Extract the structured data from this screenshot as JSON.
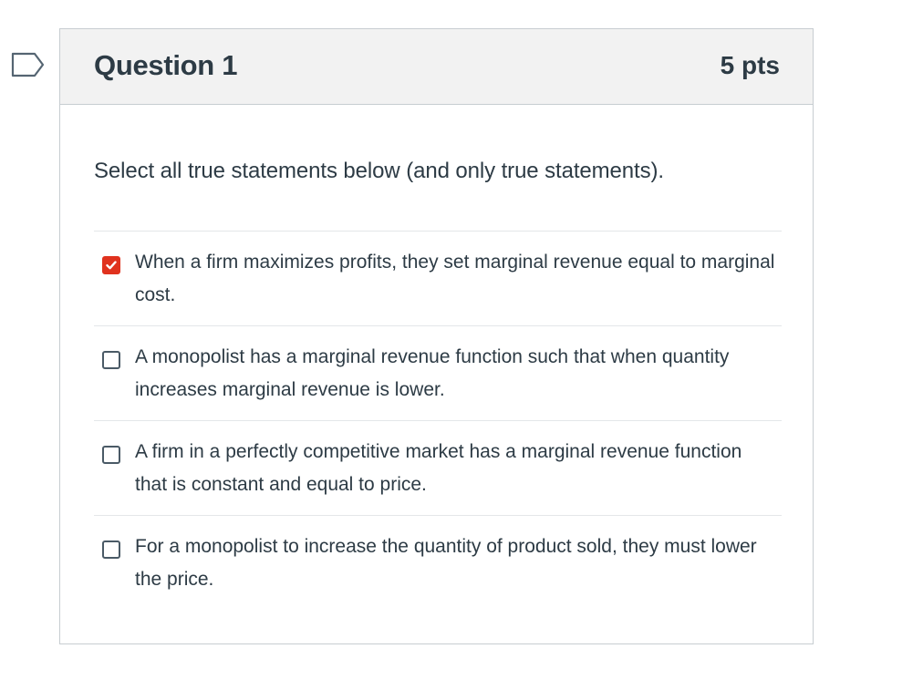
{
  "question": {
    "title": "Question 1",
    "points": "5 pts",
    "prompt": "Select all true statements below (and only true statements)."
  },
  "answers": [
    {
      "text": "When a firm maximizes profits, they set marginal revenue equal to marginal cost.",
      "checked": true
    },
    {
      "text": "A monopolist has a marginal revenue function such that when quantity increases marginal revenue is lower.",
      "checked": false
    },
    {
      "text": "A firm in a perfectly competitive market has a marginal revenue function that is constant and equal to price.",
      "checked": false
    },
    {
      "text": "For a monopolist to increase the quantity of product sold, they must lower the price.",
      "checked": false
    }
  ],
  "colors": {
    "checked": "#e0321e",
    "text": "#2d3b45",
    "header_bg": "#f2f2f2"
  }
}
